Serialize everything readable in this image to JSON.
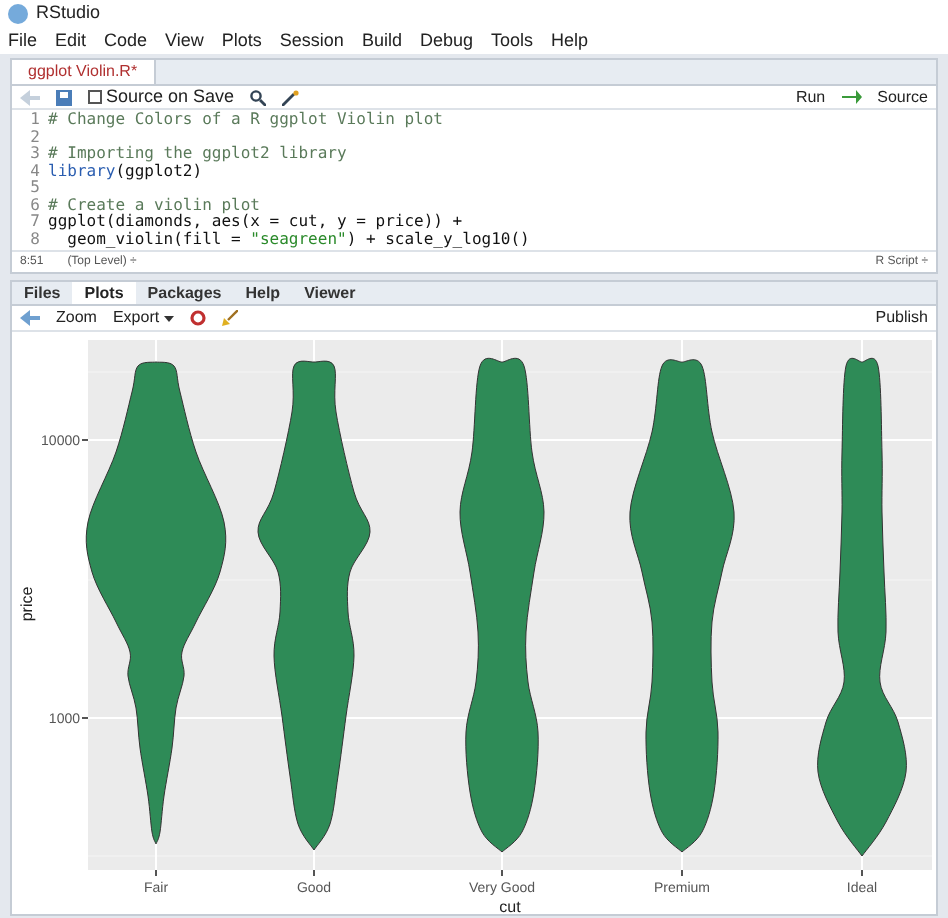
{
  "window": {
    "title": "RStudio"
  },
  "menu": [
    "File",
    "Edit",
    "Code",
    "View",
    "Plots",
    "Session",
    "Build",
    "Debug",
    "Tools",
    "Help"
  ],
  "editor": {
    "tabs": [
      {
        "label": "ggplot Violin.R*",
        "selected": true
      }
    ],
    "toolbar": {
      "source_on_save": {
        "label": "Source on Save",
        "checked": false
      },
      "run": "Run",
      "source": "Source"
    },
    "lines": [
      {
        "number": "1",
        "segments": [
          {
            "kind": "comment",
            "text": "# Change Colors of a R ggplot Violin plot"
          }
        ]
      },
      {
        "number": "2"
      },
      {
        "number": "3",
        "segments": [
          {
            "kind": "comment",
            "text": "# Importing the ggplot2 library"
          }
        ]
      },
      {
        "number": "4",
        "segments": [
          {
            "kind": "function",
            "text": "library"
          },
          {
            "kind": "code",
            "text": "(ggplot2)"
          }
        ]
      },
      {
        "number": "5"
      },
      {
        "number": "6",
        "segments": [
          {
            "kind": "comment",
            "text": "# Create a violin plot"
          }
        ]
      },
      {
        "number": "7",
        "segments": [
          {
            "kind": "code",
            "text": "ggplot(diamonds, aes(x = cut, y = price)) +"
          }
        ]
      },
      {
        "number": "8",
        "segments": [
          {
            "kind": "code",
            "text": "  geom_violin(fill = "
          },
          {
            "kind": "string",
            "text": "\"seagreen\""
          },
          {
            "kind": "code",
            "text": ") + scale_y_log10()"
          }
        ]
      }
    ],
    "status": {
      "position": "8:51",
      "scope": "(Top Level) ÷",
      "type": "R Script ÷"
    }
  },
  "pane": {
    "tabs": [
      {
        "label": "Files",
        "selected": false
      },
      {
        "label": "Plots",
        "selected": true
      },
      {
        "label": "Packages",
        "selected": false
      },
      {
        "label": "Help",
        "selected": false
      },
      {
        "label": "Viewer",
        "selected": false
      }
    ],
    "toolbar": {
      "zoom": "Zoom",
      "export": "Export",
      "publish": "Publish"
    }
  },
  "plot": {
    "ylabel": "price",
    "xlabel": "cut",
    "yticks": [
      "10000",
      "1000"
    ],
    "categories": [
      "Fair",
      "Good",
      "Very Good",
      "Premium",
      "Ideal"
    ]
  }
}
